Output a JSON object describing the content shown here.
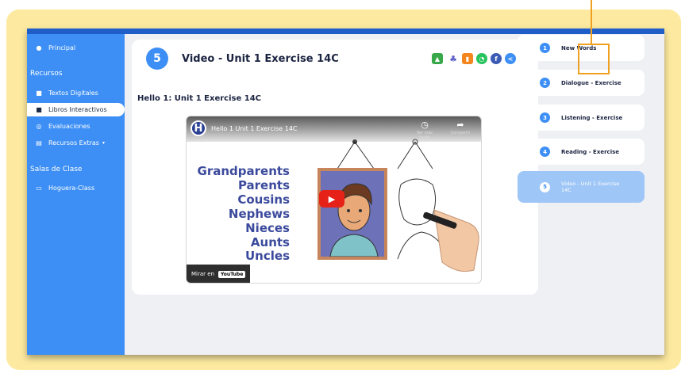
{
  "sidebar": {
    "home": "Principal",
    "recursos_heading": "Recursos",
    "items": [
      {
        "label": "Textos Digitales",
        "icon": "book-icon"
      },
      {
        "label": "Libros Interactivos",
        "icon": "book-open-icon"
      },
      {
        "label": "Evaluaciones",
        "icon": "target-icon"
      },
      {
        "label": "Recursos Extras",
        "icon": "file-icon"
      }
    ],
    "salas_heading": "Salas de Clase",
    "class_item": "Hoguera-Class"
  },
  "content": {
    "step_number": "5",
    "title": "Video - Unit 1 Exercise 14C",
    "subtitle": "Hello 1: Unit 1 Exercise 14C"
  },
  "video": {
    "channel_letter": "H",
    "title": "Hello 1 Unit 1 Exercise 14C",
    "watch_later": "Ver más tarde",
    "share": "Compartir",
    "words": [
      "Grandparents",
      "Parents",
      "Cousins",
      "Nephews",
      "Nieces",
      "Aunts",
      "Uncles"
    ],
    "watch_on": "Mirar en",
    "youtube_badge": "YouTube"
  },
  "steps": [
    {
      "number": "1",
      "label": "New Words"
    },
    {
      "number": "2",
      "label": "Dialogue - Exercise"
    },
    {
      "number": "3",
      "label": "Listening - Exercise"
    },
    {
      "number": "4",
      "label": "Reading - Exercise"
    },
    {
      "number": "5",
      "label": "Video - Unit 1 Exercise 14C"
    }
  ],
  "colors": {
    "sidebar": "#3d8ff5",
    "accent": "#1f5ec9",
    "frame": "#fdeaa0",
    "callout": "#f0a020"
  }
}
